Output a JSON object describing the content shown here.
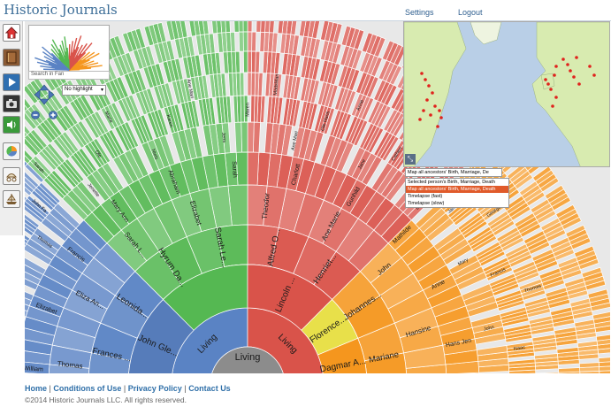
{
  "header": {
    "brand": "Historic Journals",
    "settings": "Settings",
    "logout": "Logout"
  },
  "toolbar": {
    "tools": [
      "home-icon",
      "book-icon",
      "play-icon",
      "camera-icon",
      "speaker-icon",
      "chart-icon",
      "wagon-icon",
      "ship-icon"
    ]
  },
  "fan_controls": {
    "search_placeholder": "Search in Fan",
    "highlight": "No highlight"
  },
  "map": {
    "select_value": "Map all ancestors' Birth, Marriage, De",
    "options": [
      "Selected person's Birth, Marriage, Death",
      "Map all ancestors' Birth, Marriage, Death",
      "Timelapse (fast)",
      "Timelapse (slow)"
    ],
    "selected_index": 1
  },
  "fan": {
    "center": "Living",
    "ring1": [
      "Living",
      "Living"
    ],
    "ring2": [
      "John Gle...",
      "Lincoln ...",
      "Florence...",
      "Dagmar A..."
    ],
    "ring3": [
      "Frances ...",
      "Leonida...",
      "Hyrum Da...",
      "Sarah Le...",
      "Alfred O...",
      "Henriet...",
      "Johannes...",
      "Mariane"
    ],
    "ring4": [
      "Thomas",
      "Eliza An...",
      "Sarah L...",
      "Elizabet",
      "Theodor",
      "Ane Marie",
      "John",
      "Hansine"
    ],
    "ring5": [
      "William",
      "Elizabet",
      "Francis",
      "Mary Ann",
      "Abraham",
      "Sarah",
      "Charlott",
      "Gunhild",
      "Mathilde",
      "Anne",
      "Hans Jen"
    ],
    "outer_labels": [
      "Robert",
      "Ann Brown",
      "Richard",
      "Eliza",
      "William",
      "Mary",
      "Thomas",
      "John Fa",
      "Sarah",
      "Jenette",
      "Ole",
      "Marie",
      "Niels",
      "Karen",
      "Ane Mari",
      "Jens",
      "Maren",
      "MadsMan",
      "Ane Mari",
      "Ole Hans",
      "Anne",
      "Jane",
      "Catheri",
      "Nancy",
      "Lois",
      "James M",
      "George",
      "Mary",
      "Francis",
      "Thomas",
      "John",
      "Isaac"
    ]
  },
  "colors": {
    "blue": "#5a83c4",
    "green": "#55b852",
    "red": "#d9534a",
    "orange": "#f5961e",
    "yellow": "#e8e04a",
    "center": "#8c8c8c",
    "map_land": "#d8ebb0",
    "map_water": "#b9cfe7",
    "map_dot": "#e0221c"
  },
  "footer": {
    "home": "Home",
    "conditions": "Conditions of Use",
    "privacy": "Privacy Policy",
    "contact": "Contact Us",
    "sep": "|",
    "copyright": "©2014 Historic Journals LLC.   All rights reserved."
  }
}
